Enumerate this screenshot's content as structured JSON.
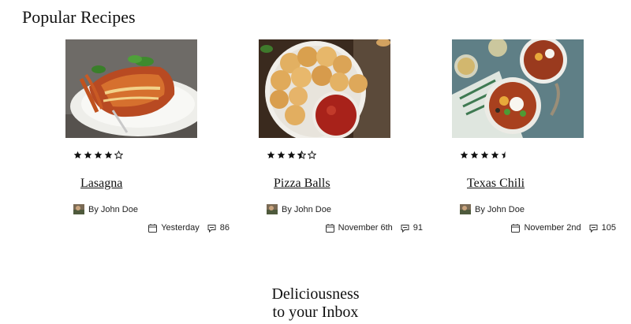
{
  "page": {
    "title": "Popular Recipes"
  },
  "recipes": [
    {
      "title": "Lasagna",
      "author": "By John Doe",
      "date": "Yesterday",
      "comments": "86",
      "rating": 4
    },
    {
      "title": "Pizza Balls",
      "author": "By John Doe",
      "date": "November 6th",
      "comments": "91",
      "rating": 3.5
    },
    {
      "title": "Texas Chili",
      "author": "By John Doe",
      "date": "November 2nd",
      "comments": "105",
      "rating": 4.5
    }
  ],
  "icons": {
    "calendar": "calendar-icon",
    "comments": "comment-icon",
    "star": "star-icon"
  },
  "newsletter": {
    "line1": "Deliciousness",
    "line2": "to your Inbox"
  }
}
